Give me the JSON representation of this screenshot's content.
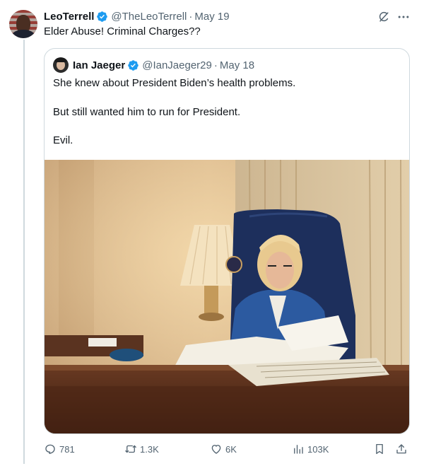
{
  "tweet": {
    "author_name": "LeoTerrell",
    "author_handle": "@TheLeoTerrell",
    "separator": "·",
    "date": "May 19",
    "text": "Elder Abuse! Criminal Charges??"
  },
  "quoted_tweet": {
    "author_name": "Ian Jaeger",
    "author_handle": "@IanJaeger29",
    "separator": "·",
    "date": "May 18",
    "lines": [
      "She knew about President Biden’s health problems.",
      "But still wanted him to run for President.",
      "Evil."
    ],
    "photo_subject": "Woman reviewing papers at a desk in an aircraft office"
  },
  "actions": {
    "replies": "781",
    "reposts": "1.3K",
    "likes": "6K",
    "views": "103K"
  },
  "icons": [
    "verified-badge-icon",
    "grok-icon",
    "more-icon",
    "reply-icon",
    "repost-icon",
    "like-icon",
    "views-icon",
    "bookmark-icon",
    "share-icon"
  ],
  "colors": {
    "text": "#0f1419",
    "secondary": "#536471",
    "verified": "#1d9bf0",
    "border": "#cfd9de"
  }
}
